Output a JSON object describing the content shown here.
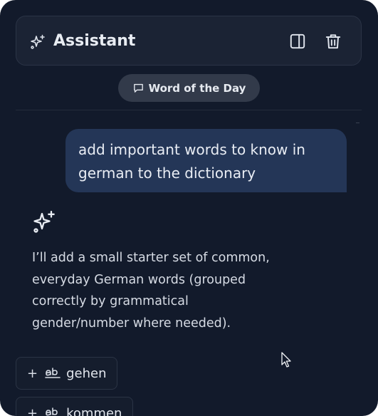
{
  "header": {
    "title": "Assistant",
    "icons": [
      "sparkles-icon",
      "sidebar-toggle-icon",
      "trash-icon"
    ]
  },
  "word_of_day": {
    "label": "Word of the Day",
    "icon": "message-square-icon"
  },
  "messages": {
    "user": "add important words to know in german to the dictionary",
    "assistant": "I’ll add a small starter set of common, everyday German words (grouped correctly by grammatical gender/number where needed)."
  },
  "words": [
    {
      "word": "gehen"
    },
    {
      "word": "kommen"
    }
  ],
  "chip_prefix": "+",
  "colors": {
    "panel_bg": "#121a2b",
    "header_bg": "#1b2334",
    "user_bubble": "#243657",
    "pill_bg": "#323a4a"
  }
}
